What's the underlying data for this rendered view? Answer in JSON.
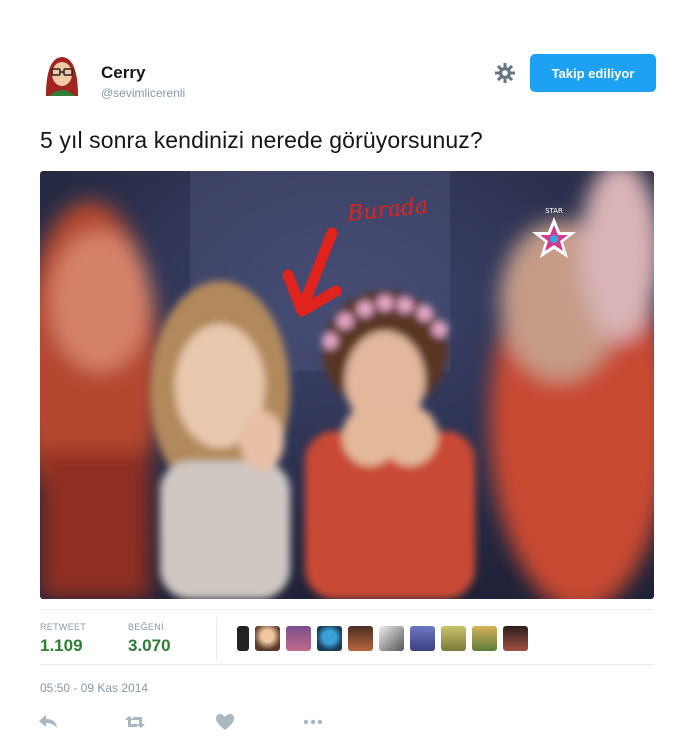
{
  "tweet": {
    "author_name": "Cerry",
    "author_handle": "@sevimlicerenli",
    "follow_label": "Takip ediliyor",
    "text": "5 yıl sonra kendinizi nerede görüyorsunuz?",
    "media": {
      "overlay_text": "Burada",
      "watermark_text": "STAR",
      "colors": {
        "arrow": "#e0231c",
        "background": "#2b3049"
      }
    },
    "stats": {
      "retweet_label": "RETWEET",
      "retweet_count": "1.109",
      "like_label": "BEĞENİ",
      "like_count": "3.070"
    },
    "likers_count": 10,
    "timestamp": "05:50 - 09 Kas 2014",
    "actions": [
      "reply-icon",
      "retweet-icon",
      "like-icon",
      "more-icon"
    ]
  },
  "colors": {
    "accent": "#1da1f2",
    "count": "#2e7d32",
    "muted": "#8899a6"
  }
}
